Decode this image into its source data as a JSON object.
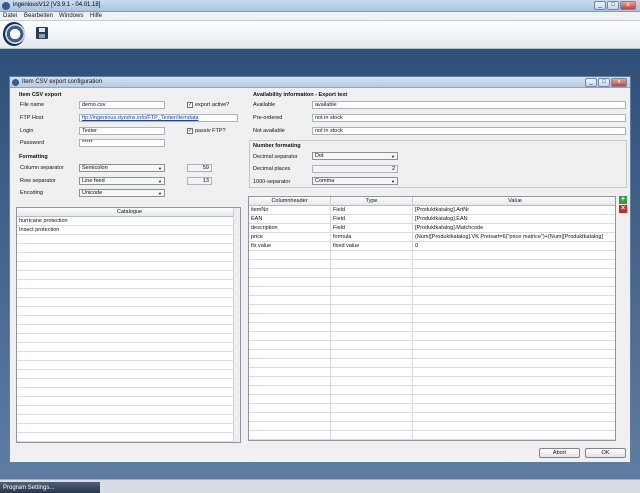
{
  "app": {
    "title": "ingeniousV12 [V3.9.1 - 04.01.18]",
    "window_buttons": [
      "_",
      "□",
      "x"
    ]
  },
  "menu": [
    "Datei",
    "Bearbeiten",
    "Windows",
    "Hilfe"
  ],
  "dialog": {
    "title": "Item CSV export configuration",
    "buttons": [
      "_",
      "□",
      "x"
    ]
  },
  "csv_export": {
    "heading": "Item CSV export",
    "file_name_label": "File name",
    "file_name": "demo.csv",
    "export_active_label": "export active?",
    "export_active_mark": "✓",
    "ftp_host_label": "FTP Host",
    "ftp_host": "ftp://ingenious.dyndns.info/FTP_Tester/itemdata",
    "login_label": "Login",
    "login": "Tester",
    "passiv_ftp_label": "passiv FTP?",
    "passiv_ftp_mark": "✓",
    "password_label": "Password",
    "password": "*****"
  },
  "formatting": {
    "heading": "Formatting",
    "column_separator_label": "Column separator",
    "column_separator": "Semicolon",
    "column_separator_code": "59",
    "row_separator_label": "Row separator",
    "row_separator": "Line feed",
    "row_separator_code": "13",
    "encoding_label": "Encoding",
    "encoding": "Unicode"
  },
  "availability": {
    "heading": "Availability information - Export text",
    "rows": [
      {
        "label": "Available",
        "value": "available"
      },
      {
        "label": "Pre-ordered",
        "value": "not in stock"
      },
      {
        "label": "Not available",
        "value": "not in stock"
      }
    ]
  },
  "number_formatting": {
    "heading": "Number formating",
    "decimal_separator_label": "Decimal separator",
    "decimal_separator": "Dot",
    "decimal_places_label": "Decimal places",
    "decimal_places": "2",
    "thousand_separator_label": "1000-separator",
    "thousand_separator": "Comma"
  },
  "catalogue": {
    "header": "Catalogue",
    "rows": [
      "hurricane protection",
      "Insect protection"
    ]
  },
  "columns_table": {
    "headers": [
      "Columnheader",
      "Type",
      "Value"
    ],
    "rows": [
      [
        "itemNo",
        "Field",
        "[Produktkatalog].ArtNr"
      ],
      [
        "EAN",
        "Field",
        "[Produktkatalog].EAN"
      ],
      [
        "description",
        "Field",
        "[Produktkatalog].Matchcode"
      ],
      [
        "price",
        "formula",
        "(Num([Produktkatalog].VK Preisart=6(\"price matrice\")+(Num([Produktkatalog]"
      ],
      [
        "fix value",
        "fixed value",
        "0"
      ]
    ],
    "add_icon": "add-icon",
    "delete_icon": "delete-icon"
  },
  "actions": {
    "abort": "Abort",
    "ok": "OK"
  },
  "statusbar": {
    "tab": "Program Settings..."
  }
}
